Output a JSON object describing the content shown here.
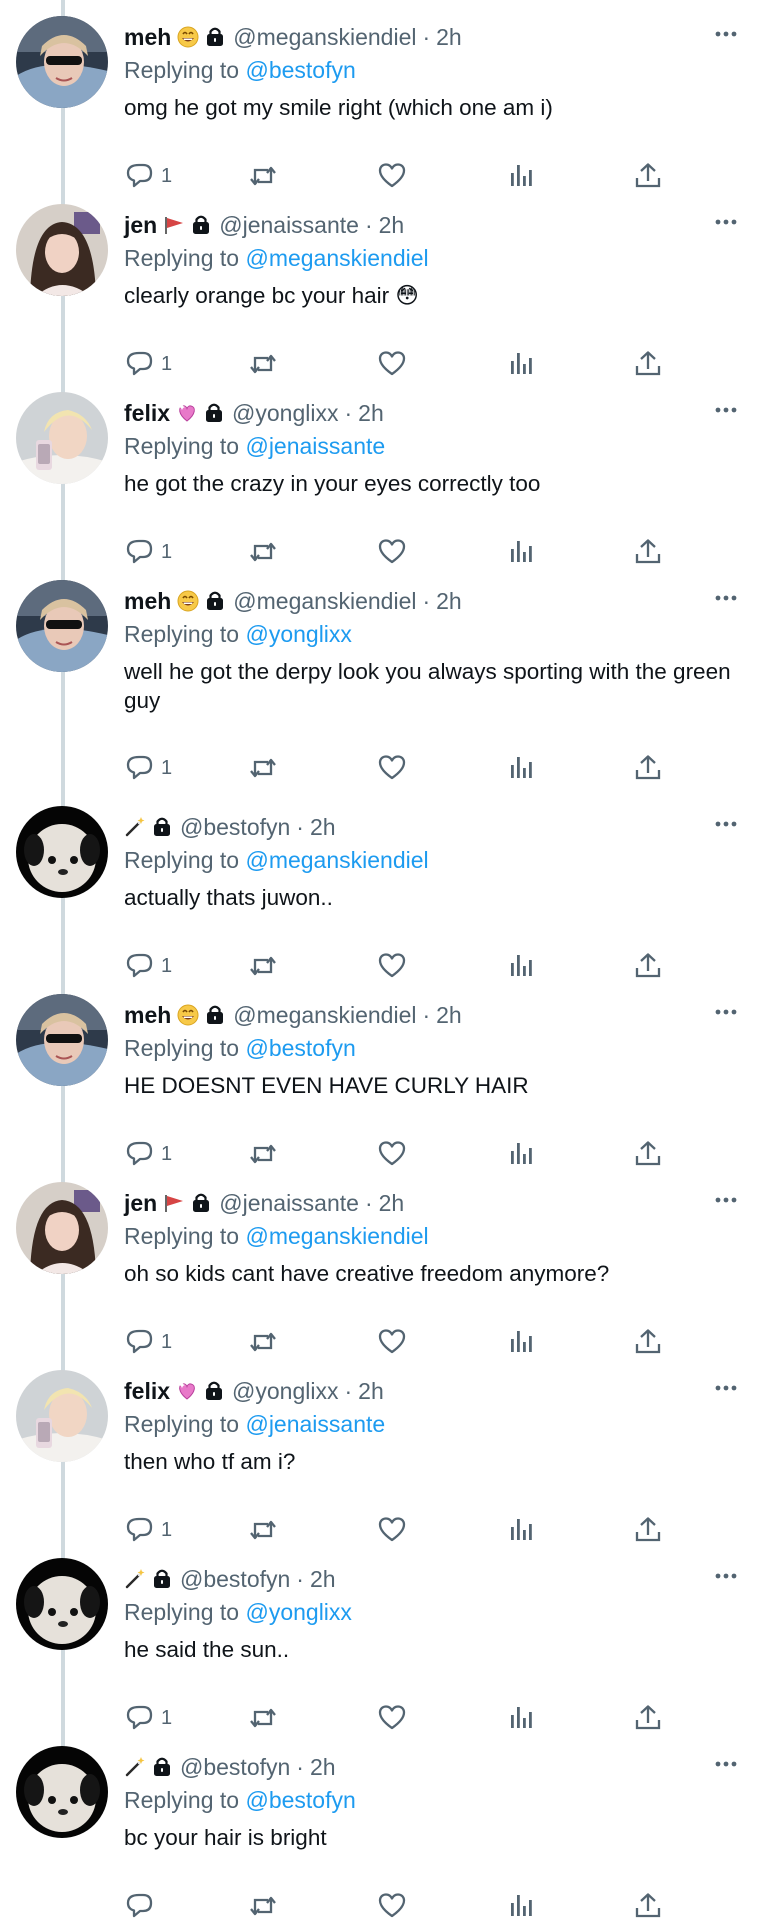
{
  "thread": {
    "tweets": [
      {
        "name": "meh",
        "handle": "@meganskiendiel",
        "time": "2h",
        "replying_label": "Replying to",
        "replying_to": "@bestofyn",
        "text": "omg he got my smile right (which one am i)",
        "reply_count": "1",
        "badge_icon": "grinning-star-eyes-emoji",
        "avatar_icon": "girl-selfie-avatar"
      },
      {
        "name": "jen",
        "handle": "@jenaissante",
        "time": "2h",
        "replying_label": "Replying to",
        "replying_to": "@meganskiendiel",
        "text": "clearly orange bc your hair 😳",
        "reply_count": "1",
        "badge_icon": "red-flag-emoji",
        "avatar_icon": "girl-portrait-avatar"
      },
      {
        "name": "felix",
        "handle": "@yonglixx",
        "time": "2h",
        "replying_label": "Replying to",
        "replying_to": "@jenaissante",
        "text": "he got the crazy in your eyes correctly too",
        "reply_count": "1",
        "badge_icon": "sparkling-heart-emoji",
        "avatar_icon": "blonde-selfie-avatar"
      },
      {
        "name": "meh",
        "handle": "@meganskiendiel",
        "time": "2h",
        "replying_label": "Replying to",
        "replying_to": "@yonglixx",
        "text": "well he got the derpy look you always sporting with the green guy",
        "reply_count": "1",
        "badge_icon": "grinning-star-eyes-emoji",
        "avatar_icon": "girl-selfie-avatar"
      },
      {
        "name": "",
        "handle": "@bestofyn",
        "time": "2h",
        "replying_label": "Replying to",
        "replying_to": "@meganskiendiel",
        "text": "actually thats juwon..",
        "reply_count": "1",
        "badge_icon": "magic-wand-emoji",
        "avatar_icon": "plush-toy-avatar"
      },
      {
        "name": "meh",
        "handle": "@meganskiendiel",
        "time": "2h",
        "replying_label": "Replying to",
        "replying_to": "@bestofyn",
        "text": "HE DOESNT EVEN HAVE CURLY HAIR",
        "reply_count": "1",
        "badge_icon": "grinning-star-eyes-emoji",
        "avatar_icon": "girl-selfie-avatar"
      },
      {
        "name": "jen",
        "handle": "@jenaissante",
        "time": "2h",
        "replying_label": "Replying to",
        "replying_to": "@meganskiendiel",
        "text": "oh so kids cant have creative freedom anymore?",
        "reply_count": "1",
        "badge_icon": "red-flag-emoji",
        "avatar_icon": "girl-portrait-avatar"
      },
      {
        "name": "felix",
        "handle": "@yonglixx",
        "time": "2h",
        "replying_label": "Replying to",
        "replying_to": "@jenaissante",
        "text": "then who tf am i?",
        "reply_count": "1",
        "badge_icon": "sparkling-heart-emoji",
        "avatar_icon": "blonde-selfie-avatar"
      },
      {
        "name": "",
        "handle": "@bestofyn",
        "time": "2h",
        "replying_label": "Replying to",
        "replying_to": "@yonglixx",
        "text": "he said the sun..",
        "reply_count": "1",
        "badge_icon": "magic-wand-emoji",
        "avatar_icon": "plush-toy-avatar"
      },
      {
        "name": "",
        "handle": "@bestofyn",
        "time": "2h",
        "replying_label": "Replying to",
        "replying_to": "@bestofyn",
        "text": "bc your hair is bright",
        "reply_count": "",
        "badge_icon": "magic-wand-emoji",
        "avatar_icon": "plush-toy-avatar"
      }
    ]
  },
  "colors": {
    "text_primary": "#0f1419",
    "text_secondary": "#536471",
    "link": "#1d9bf0",
    "thread_line": "#cfd9de"
  }
}
